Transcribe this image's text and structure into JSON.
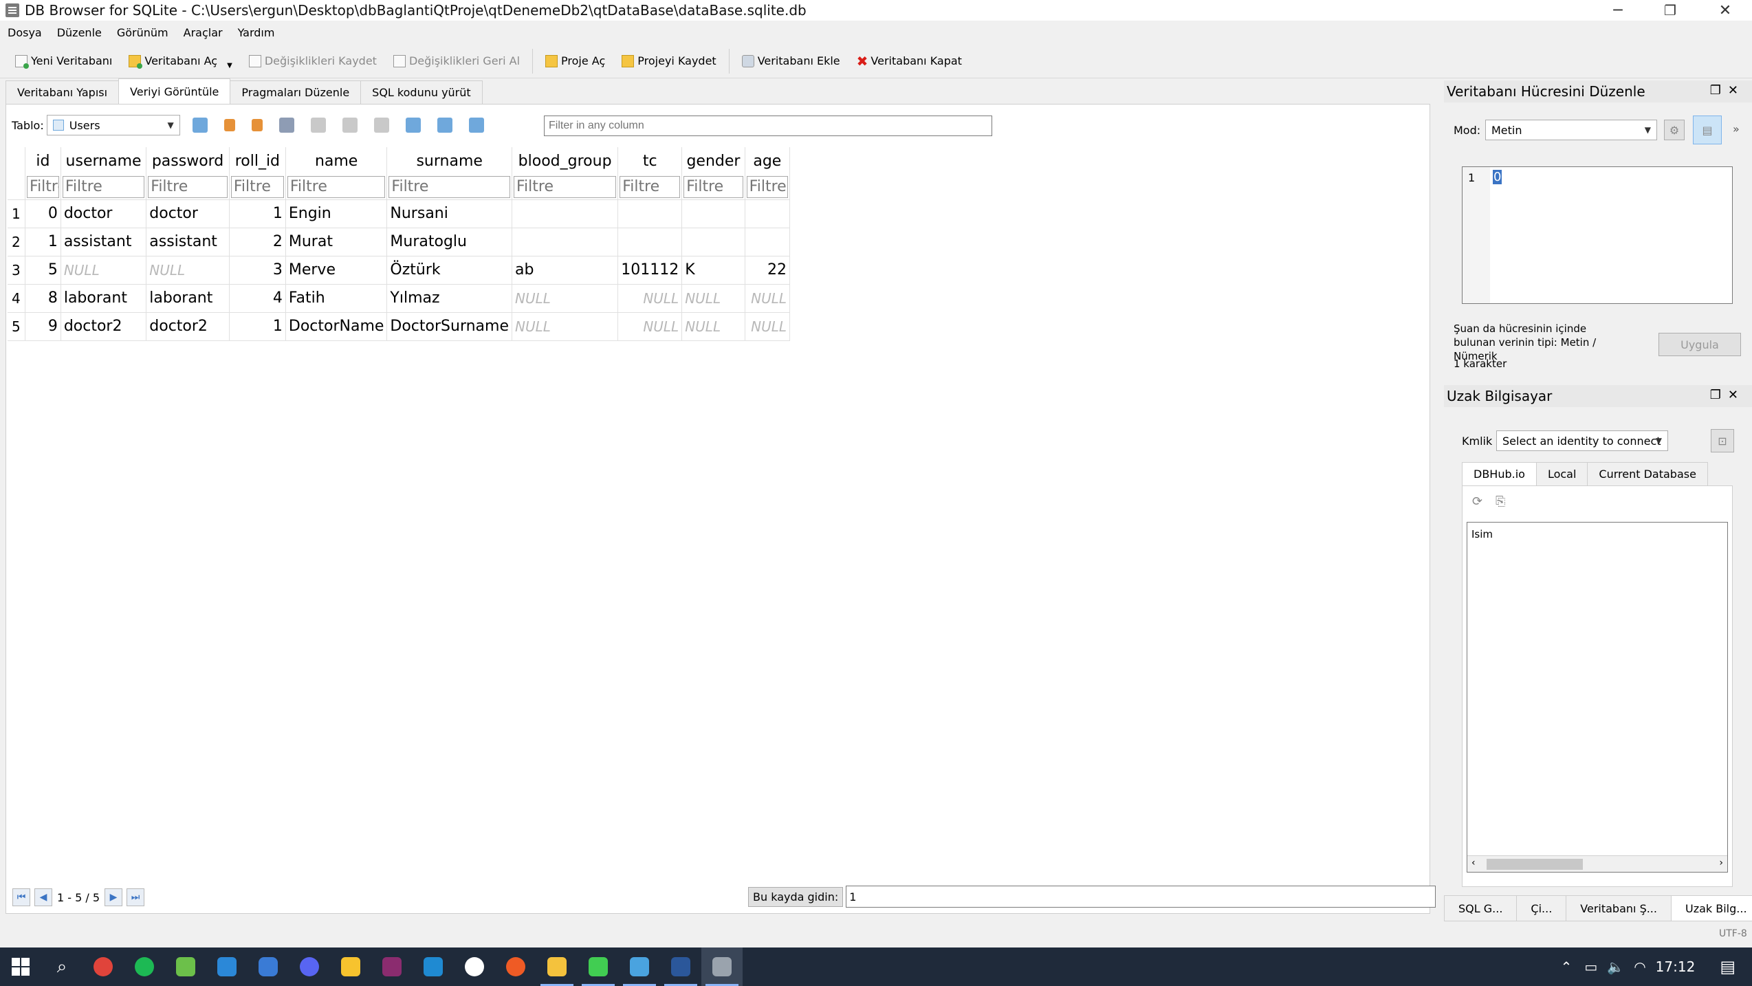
{
  "window": {
    "title": "DB Browser for SQLite - C:\\Users\\ergun\\Desktop\\dbBaglantiQtProje\\qtDenemeDb2\\qtDataBase\\dataBase.sqlite.db",
    "min": "─",
    "max": "❐",
    "close": "✕"
  },
  "menu": [
    "Dosya",
    "Düzenle",
    "Görünüm",
    "Araçlar",
    "Yardım"
  ],
  "toolbar": {
    "new_db": "Yeni Veritabanı",
    "open_db": "Veritabanı Aç",
    "write": "Değişiklikleri Kaydet",
    "revert": "Değişiklikleri Geri Al",
    "open_project": "Proje Aç",
    "save_project": "Projeyi Kaydet",
    "attach": "Veritabanı Ekle",
    "close_db": "Veritabanı Kapat"
  },
  "tabs": [
    "Veritabanı Yapısı",
    "Veriyi Görüntüle",
    "Pragmaları Düzenle",
    "SQL kodunu yürüt"
  ],
  "browse": {
    "table_label": "Tablo:",
    "table": "Users",
    "filter_placeholder": "Filter in any column",
    "filter_cell": "Filtre"
  },
  "grid": {
    "columns": [
      "id",
      "username",
      "password",
      "roll_id",
      "name",
      "surname",
      "blood_group",
      "tc",
      "gender",
      "age"
    ],
    "rows": [
      {
        "n": "1",
        "id": "0",
        "username": "doctor",
        "password": "doctor",
        "roll_id": "1",
        "name": "Engin",
        "surname": "Nursani",
        "blood_group": "",
        "tc": "",
        "gender": "",
        "age": ""
      },
      {
        "n": "2",
        "id": "1",
        "username": "assistant",
        "password": "assistant",
        "roll_id": "2",
        "name": "Murat",
        "surname": "Muratoglu",
        "blood_group": "",
        "tc": "",
        "gender": "",
        "age": ""
      },
      {
        "n": "3",
        "id": "5",
        "username": "NULL",
        "password": "NULL",
        "roll_id": "3",
        "name": "Merve",
        "surname": "Öztürk",
        "blood_group": "ab",
        "tc": "101112",
        "gender": "K",
        "age": "22"
      },
      {
        "n": "4",
        "id": "8",
        "username": "laborant",
        "password": "laborant",
        "roll_id": "4",
        "name": "Fatih",
        "surname": "Yılmaz",
        "blood_group": "NULL",
        "tc": "NULL",
        "gender": "NULL",
        "age": "NULL"
      },
      {
        "n": "5",
        "id": "9",
        "username": "doctor2",
        "password": "doctor2",
        "roll_id": "1",
        "name": "DoctorName",
        "surname": "DoctorSurname",
        "blood_group": "NULL",
        "tc": "NULL",
        "gender": "NULL",
        "age": "NULL"
      }
    ]
  },
  "nav": {
    "range": "1 - 5 / 5",
    "goto_label": "Bu kayda gidin:",
    "goto_value": "1"
  },
  "edit_dock": {
    "title": "Veritabanı Hücresini Düzenle",
    "mode_label": "Mod:",
    "mode": "Metin",
    "line_no": "1",
    "cell_value": "0",
    "type_info": "Şuan da hücresinin içinde bulunan verinin tipi: Metin / Nümerik",
    "chars": "1 karakter",
    "apply": "Uygula"
  },
  "remote_dock": {
    "title": "Uzak Bilgisayar",
    "identity_label": "Kmlik",
    "identity": "Select an identity to connect",
    "tabs": [
      "DBHub.io",
      "Local",
      "Current Database"
    ],
    "col": "Isim"
  },
  "dock_tabs": [
    "SQL G...",
    "Çi...",
    "Veritabanı Ş...",
    "Uzak Bilg..."
  ],
  "encoding": "UTF-8",
  "taskbar": {
    "time": "17:12"
  },
  "colors": {
    "accent": "#3b74c4",
    "taskbar": "#1f2a3a"
  }
}
